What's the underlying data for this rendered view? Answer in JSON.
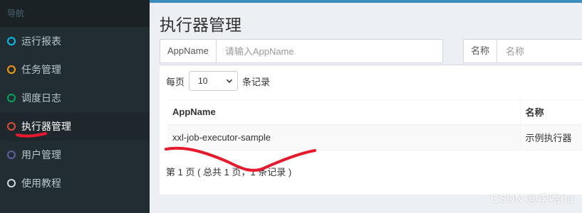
{
  "sidebar": {
    "header": "导航",
    "items": [
      {
        "label": "运行报表",
        "icon": "circle-outline-icon",
        "color": "#00c0ef",
        "active": false
      },
      {
        "label": "任务管理",
        "icon": "circle-outline-icon",
        "color": "#f39c12",
        "active": false
      },
      {
        "label": "调度日志",
        "icon": "circle-outline-icon",
        "color": "#00a65a",
        "active": false
      },
      {
        "label": "执行器管理",
        "icon": "circle-outline-icon",
        "color": "#dd4b39",
        "active": true
      },
      {
        "label": "用户管理",
        "icon": "circle-outline-icon",
        "color": "#605ca8",
        "active": false
      },
      {
        "label": "使用教程",
        "icon": "circle-outline-icon",
        "color": "#d2d6de",
        "active": false
      }
    ]
  },
  "main": {
    "title": "执行器管理",
    "filters": {
      "appname_label": "AppName",
      "appname_placeholder": "请输入AppName",
      "name_label": "名称",
      "name_placeholder": "名称"
    },
    "length": {
      "prefix": "每页",
      "selected": "10",
      "suffix": "条记录"
    },
    "table": {
      "headers": [
        "AppName",
        "名称"
      ],
      "rows": [
        [
          "xxl-job-executor-sample",
          "示例执行器"
        ]
      ]
    },
    "pagination_info": "第 1 页 ( 总共 1 页，1 条记录 )"
  },
  "watermark": "CSDN @李哈ha",
  "colors": {
    "accent": "#3c8dbc",
    "sidebar_bg": "#222d32",
    "annotation_red": "#e8192c"
  }
}
